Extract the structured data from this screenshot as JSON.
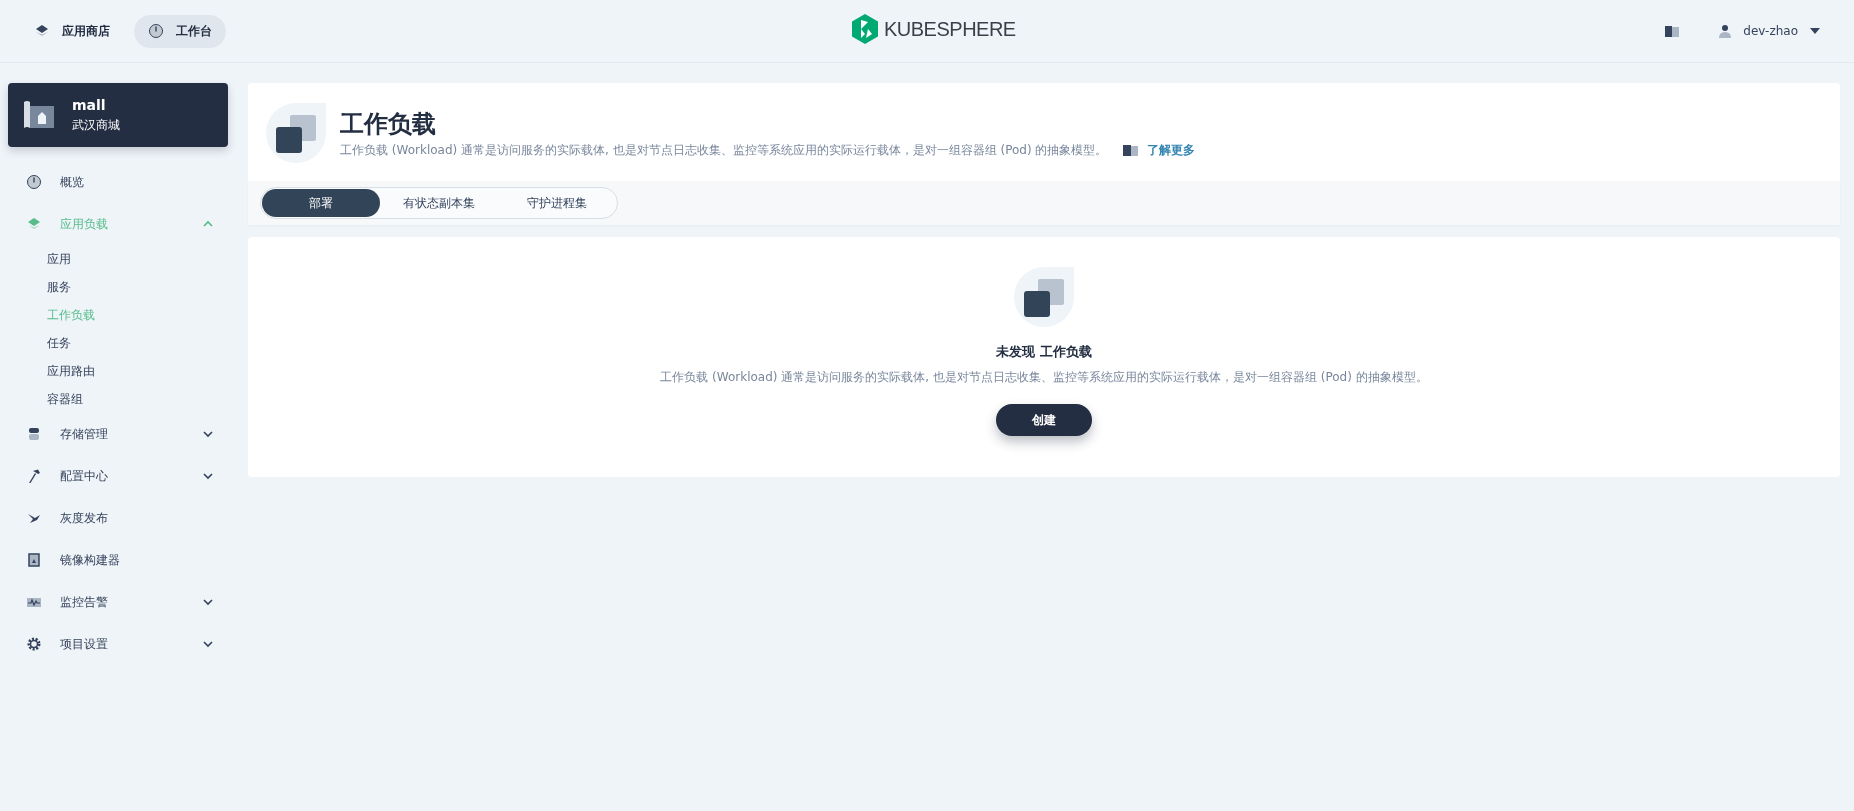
{
  "topbar": {
    "links": [
      {
        "label": "应用商店",
        "selected": false
      },
      {
        "label": "工作台",
        "selected": true
      }
    ],
    "logo": "KUBESPHERE",
    "user": "dev-zhao"
  },
  "project": {
    "name": "mall",
    "description": "武汉商城"
  },
  "nav": [
    {
      "label": "概览",
      "selected": false
    },
    {
      "label": "应用负载",
      "selected": true,
      "expanded": true,
      "children": [
        {
          "label": "应用",
          "selected": false
        },
        {
          "label": "服务",
          "selected": false
        },
        {
          "label": "工作负载",
          "selected": true
        },
        {
          "label": "任务",
          "selected": false
        },
        {
          "label": "应用路由",
          "selected": false
        },
        {
          "label": "容器组",
          "selected": false
        }
      ]
    },
    {
      "label": "存储管理",
      "selected": false,
      "expanded": false
    },
    {
      "label": "配置中心",
      "selected": false,
      "expanded": false
    },
    {
      "label": "灰度发布",
      "selected": false
    },
    {
      "label": "镜像构建器",
      "selected": false
    },
    {
      "label": "监控告警",
      "selected": false,
      "expanded": false
    },
    {
      "label": "项目设置",
      "selected": false,
      "expanded": false
    }
  ],
  "page": {
    "title": "工作负载",
    "description": "工作负载 (Workload) 通常是访问服务的实际载体, 也是对节点日志收集、监控等系统应用的实际运行载体，是对一组容器组 (Pod) 的抽象模型。",
    "learn_more": "了解更多"
  },
  "tabs": [
    {
      "label": "部署",
      "selected": true
    },
    {
      "label": "有状态副本集",
      "selected": false
    },
    {
      "label": "守护进程集",
      "selected": false
    }
  ],
  "empty": {
    "title": "未发现 工作负载",
    "description": "工作负载 (Workload) 通常是访问服务的实际载体, 也是对节点日志收集、监控等系统应用的实际运行载体，是对一组容器组 (Pod) 的抽象模型。",
    "button": "创建"
  }
}
